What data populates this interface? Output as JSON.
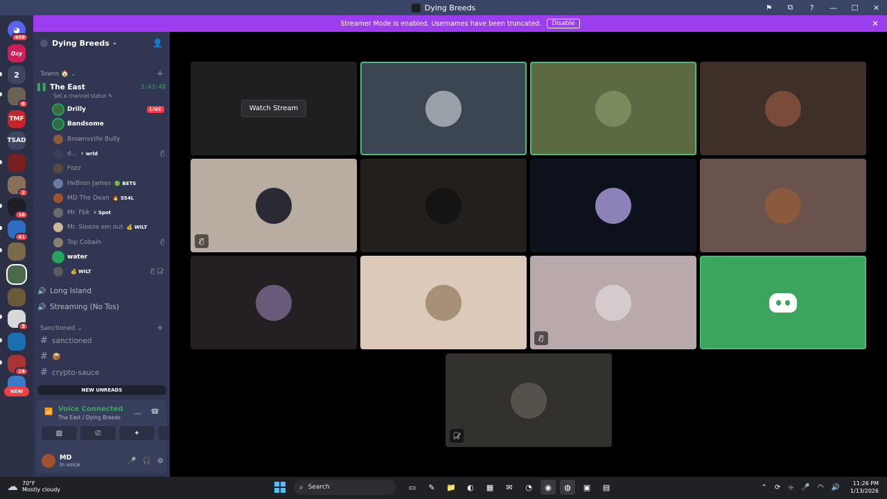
{
  "window": {
    "title": "Dying Breeds",
    "controls": [
      "⚑",
      "⧉",
      "?",
      "—",
      "☐",
      "✕"
    ]
  },
  "banner": {
    "text": "Streamer Mode is enabled. Usernames have been truncated.",
    "disable_label": "Disable",
    "close_icon": "✕"
  },
  "guild_rail": {
    "guilds": [
      {
        "label": "",
        "badge": "469"
      },
      {
        "label": "Dsy",
        "badge": ""
      },
      {
        "label": "2",
        "badge": ""
      },
      {
        "label": "",
        "badge": "6"
      },
      {
        "label": "TMF",
        "badge": ""
      },
      {
        "label": "TSAD",
        "badge": ""
      },
      {
        "label": "",
        "badge": ""
      },
      {
        "label": "",
        "badge": "2"
      },
      {
        "label": "",
        "badge": "16"
      },
      {
        "label": "",
        "badge": "41"
      },
      {
        "label": "",
        "badge": ""
      },
      {
        "label": "",
        "badge": ""
      },
      {
        "label": "",
        "badge": ""
      },
      {
        "label": "",
        "badge": "3"
      },
      {
        "label": "",
        "badge": ""
      },
      {
        "label": "",
        "badge": "24"
      },
      {
        "label": "",
        "badge": ""
      }
    ],
    "new_label": "NEW"
  },
  "sidebar": {
    "server_name": "Dying Breeds",
    "categories": {
      "towns": "Towns 🏠",
      "sanctioned": "Sanctioned"
    },
    "active_channel": {
      "name": "The East",
      "timer": "3:43:48",
      "status": "Set a channel status"
    },
    "members": [
      {
        "name": "Drilly",
        "tag": "",
        "live": "LIVE",
        "mutes": "",
        "color": "#3b6b3f",
        "speaking": true,
        "bright": true
      },
      {
        "name": "Bandsome",
        "tag": "",
        "live": "",
        "mutes": "",
        "color": "#2e6b46",
        "speaking": true,
        "bright": true
      },
      {
        "name": "Brownsville Bully",
        "tag": "",
        "live": "",
        "mutes": "",
        "color": "#8a5a3c",
        "speaking": false,
        "bright": false
      },
      {
        "name": "d...",
        "tag": "⚡ wrld",
        "live": "",
        "mutes": "🎙̸",
        "color": "#3c3f57",
        "speaking": false,
        "bright": false
      },
      {
        "name": "Fozz",
        "tag": "",
        "live": "",
        "mutes": "",
        "color": "#5a4a3c",
        "speaking": false,
        "bright": false
      },
      {
        "name": "HeBron James",
        "tag": "🟢 BETS",
        "live": "",
        "mutes": "",
        "color": "#6b7aa0",
        "speaking": false,
        "bright": false
      },
      {
        "name": "MD The Dean",
        "tag": "🔥 SS4L",
        "live": "",
        "mutes": "",
        "color": "#a0522d",
        "speaking": false,
        "bright": false
      },
      {
        "name": "Mr. Fbk",
        "tag": "⚡ Spot",
        "live": "",
        "mutes": "",
        "color": "#6b6b6b",
        "speaking": false,
        "bright": false
      },
      {
        "name": "Mr. Sleeze em out",
        "tag": "💰 WILT",
        "live": "",
        "mutes": "",
        "color": "#c9b79c",
        "speaking": false,
        "bright": false
      },
      {
        "name": "Top Cobain",
        "tag": "",
        "live": "",
        "mutes": "🎙̸",
        "color": "#8a8070",
        "speaking": false,
        "bright": false
      },
      {
        "name": "water",
        "tag": "",
        "live": "",
        "mutes": "",
        "color": "#23a55a",
        "speaking": true,
        "bright": true
      },
      {
        "name": "",
        "tag": "💰 WILT",
        "live": "",
        "mutes": "🎙̸ 🎧̸",
        "color": "#5a5a5a",
        "speaking": false,
        "bright": false
      }
    ],
    "voice_channels": [
      "Long Island",
      "Streaming (No Tos)"
    ],
    "text_channels": [
      "sanctioned",
      "📦",
      "crypto-sauce"
    ],
    "new_unreads": "NEW UNREADS"
  },
  "voice_panel": {
    "title": "Voice Connected",
    "subtitle": "The East / Dying Breeds",
    "user_name": "MD",
    "user_status": "In voice"
  },
  "stage": {
    "watch_stream": "Watch Stream",
    "tiles": [
      {
        "bg": "#1f1f1f",
        "avatar": "",
        "speaking": false,
        "corner": "",
        "kind": "stream"
      },
      {
        "bg": "#3c4652",
        "avatar": "#9aa1a8",
        "speaking": true,
        "corner": "",
        "kind": "avatar"
      },
      {
        "bg": "#5b6a43",
        "avatar": "#7a8a5c",
        "speaking": true,
        "corner": "",
        "kind": "avatar"
      },
      {
        "bg": "#3f2f29",
        "avatar": "#7a4a3a",
        "speaking": false,
        "corner": "",
        "kind": "avatar"
      },
      {
        "bg": "#b8ada0",
        "avatar": "#2a2a35",
        "speaking": false,
        "corner": "🎙̸",
        "kind": "avatar"
      },
      {
        "bg": "#231f1d",
        "avatar": "#141414",
        "speaking": false,
        "corner": "",
        "kind": "avatar"
      },
      {
        "bg": "#0d111c",
        "avatar": "#8c82b8",
        "speaking": false,
        "corner": "",
        "kind": "avatar"
      },
      {
        "bg": "#6a534c",
        "avatar": "#8b5a3c",
        "speaking": false,
        "corner": "",
        "kind": "avatar"
      },
      {
        "bg": "#231f22",
        "avatar": "#6a5a7a",
        "speaking": false,
        "corner": "",
        "kind": "avatar"
      },
      {
        "bg": "#ddc9b9",
        "avatar": "#a88f78",
        "speaking": false,
        "corner": "",
        "kind": "avatar"
      },
      {
        "bg": "#b9a9aa",
        "avatar": "#d4cccc",
        "speaking": false,
        "corner": "🎙̸",
        "kind": "avatar"
      },
      {
        "bg": "#3ba55d",
        "avatar": "",
        "speaking": true,
        "corner": "",
        "kind": "discord"
      },
      {
        "bg": "#33312d",
        "avatar": "#55524c",
        "speaking": false,
        "corner": "🎧̸",
        "kind": "avatar"
      }
    ]
  },
  "taskbar": {
    "weather_temp": "70°F",
    "weather_cond": "Mostly cloudy",
    "search_label": "Search",
    "time": "11:26 PM",
    "date": "1/13/2026",
    "apps": [
      "▭",
      "✎",
      "📁",
      "◐",
      "▦",
      "✉",
      "◔",
      "◉",
      "◍",
      "▣",
      "▤"
    ]
  }
}
